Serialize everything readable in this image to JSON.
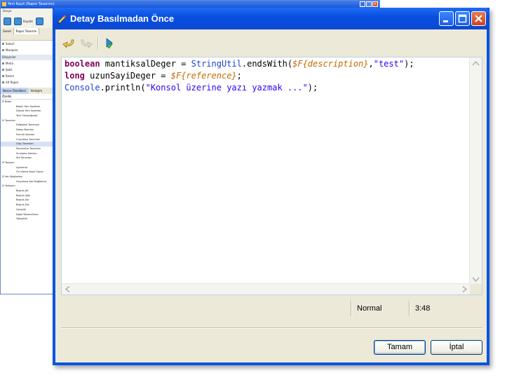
{
  "background_app": {
    "title": "Yeni Kayıt (Rapor Tasarımı)",
    "menu_label": "Dosya",
    "toolbar": [
      {
        "label": "",
        "icon": "save-icon"
      },
      {
        "label": "Kaydet",
        "icon": "save-icon"
      },
      {
        "label": "",
        "icon": "save-as-icon"
      }
    ],
    "side_tabs": [
      "Genel",
      "Rapor Tasarımı"
    ],
    "select_items": [
      "Select",
      "Marquee"
    ],
    "components_header": "Bileşenler",
    "components": [
      "Metin",
      "Şekil",
      "Resim",
      "Alt Rapor"
    ],
    "properties_tabs": [
      "Nesne Özellikleri",
      "Yerleşim"
    ],
    "properties_header": "Özellik",
    "properties": [
      {
        "text": "Baskı",
        "kind": "grp"
      },
      {
        "text": "Başlık Yeni Sayfada",
        "kind": "sub"
      },
      {
        "text": "Dipnot Yeni Sayfada",
        "kind": "sub"
      },
      {
        "text": "Yeni Olmadığında",
        "kind": "sub"
      },
      {
        "text": "Tanımlar",
        "kind": "grp"
      },
      {
        "text": "Değişken Tanımları",
        "kind": "sub"
      },
      {
        "text": "Detay Bantları",
        "kind": "sub"
      },
      {
        "text": "Formül Alanları",
        "kind": "sub"
      },
      {
        "text": "Gruplama Tanımları",
        "kind": "sub"
      },
      {
        "text": "Olay Tanımları",
        "kind": "sub sel"
      },
      {
        "text": "Parametre Tanımları",
        "kind": "sub"
      },
      {
        "text": "Sıralama Alanları",
        "kind": "sub"
      },
      {
        "text": "Stil Tanımları",
        "kind": "sub"
      },
      {
        "text": "Tasarım",
        "kind": "grp"
      },
      {
        "text": "Açıklama",
        "kind": "sub"
      },
      {
        "text": "Ön İzleme Kayıt Sayısı",
        "kind": "sub"
      },
      {
        "text": "Veri Bağlantısı",
        "kind": "grp"
      },
      {
        "text": "Gruplama Veri Bağlantısı",
        "kind": "sub"
      },
      {
        "text": "Yerleşim",
        "kind": "grp"
      },
      {
        "text": "Boşluk-Alt",
        "kind": "sub"
      },
      {
        "text": "Boşluk-Sağ",
        "kind": "sub"
      },
      {
        "text": "Boşluk-Sol",
        "kind": "sub"
      },
      {
        "text": "Boşluk-Üst",
        "kind": "sub"
      },
      {
        "text": "Genişlik",
        "kind": "sub"
      },
      {
        "text": "Kağıt Yönlendirme",
        "kind": "sub"
      },
      {
        "text": "Yükseklik",
        "kind": "sub"
      }
    ]
  },
  "dialog": {
    "title": "Detay Basılmadan Önce",
    "toolbar": {
      "undo_icon": "undo-icon",
      "redo_icon": "redo-icon",
      "compile_icon": "compile-check-icon"
    },
    "code_lines": [
      [
        {
          "t": "boolean",
          "c": "kw"
        },
        {
          "t": " mantiksalDeger = ",
          "c": ""
        },
        {
          "t": "StringUtil",
          "c": "cls"
        },
        {
          "t": ".endsWith(",
          "c": ""
        },
        {
          "t": "$F{description}",
          "c": "fld"
        },
        {
          "t": ",",
          "c": ""
        },
        {
          "t": "\"test\"",
          "c": "str"
        },
        {
          "t": ");",
          "c": ""
        }
      ],
      [
        {
          "t": "long",
          "c": "kw"
        },
        {
          "t": " uzunSayiDeger = ",
          "c": ""
        },
        {
          "t": "$F{reference}",
          "c": "fld"
        },
        {
          "t": ";",
          "c": ""
        }
      ],
      [
        {
          "t": "Console",
          "c": "cls"
        },
        {
          "t": ".println(",
          "c": ""
        },
        {
          "t": "\"Konsol üzerine yazı yazmak ...\"",
          "c": "str"
        },
        {
          "t": ");",
          "c": ""
        }
      ]
    ],
    "status": {
      "mode": "Normal",
      "position": "3:48"
    },
    "buttons": {
      "ok": "Tamam",
      "cancel": "İptal"
    },
    "colors": {
      "keyword": "#7f0055",
      "class": "#1f3fd1",
      "string": "#2a00ff",
      "field": "#c46a00",
      "titlebar": "#0a55e0"
    }
  }
}
